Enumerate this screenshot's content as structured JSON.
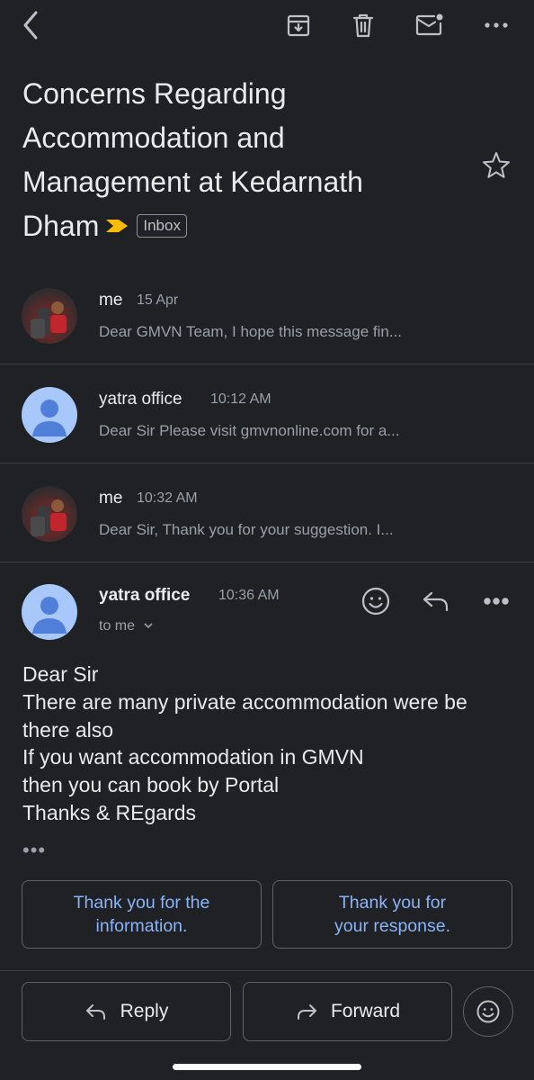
{
  "header": {
    "back_icon": "chevron-left-icon",
    "archive_icon": "archive-icon",
    "delete_icon": "trash-icon",
    "mark_unread_icon": "mail-unread-icon",
    "more_icon": "more-horizontal-icon"
  },
  "subject": {
    "title": "Concerns Regarding Accommodation and Management at Kedarnath Dham",
    "label": "Inbox",
    "importance_color": "#fbbc04"
  },
  "thread": [
    {
      "sender": "me",
      "time": "15 Apr",
      "snippet": "Dear GMVN Team, I hope this message fin...",
      "avatar": "photo"
    },
    {
      "sender": "yatra office",
      "time": "10:12 AM",
      "snippet": "Dear Sir Please visit gmvnonline.com for a...",
      "avatar": "default"
    },
    {
      "sender": "me",
      "time": "10:32 AM",
      "snippet": "Dear Sir, Thank you for your suggestion. I...",
      "avatar": "photo"
    }
  ],
  "open_message": {
    "sender": "yatra office",
    "time": "10:36 AM",
    "recipient": "to me",
    "body": "Dear Sir\nThere are many private accommodation were be there also\nIf you want accommodation in GMVN\nthen you can book  by Portal\nThanks & REgards",
    "more": "•••"
  },
  "smart_replies": [
    "Thank you for the information.",
    "Thank you for your response."
  ],
  "actions": {
    "reply_label": "Reply",
    "forward_label": "Forward"
  },
  "colors": {
    "background": "#202124",
    "accent": "#8ab4f8",
    "avatar_default": "#a8c7fa"
  }
}
